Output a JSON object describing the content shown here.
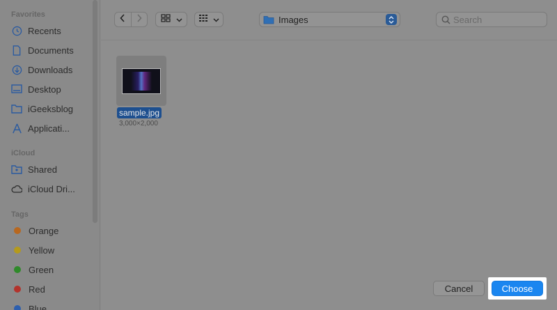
{
  "sidebar": {
    "favorites_header": "Favorites",
    "favorites": [
      {
        "label": "Recents",
        "icon": "clock-icon"
      },
      {
        "label": "Documents",
        "icon": "document-icon"
      },
      {
        "label": "Downloads",
        "icon": "download-icon"
      },
      {
        "label": "Desktop",
        "icon": "desktop-icon"
      },
      {
        "label": "iGeeksblog",
        "icon": "folder-icon"
      },
      {
        "label": "Applicati...",
        "icon": "applications-icon"
      }
    ],
    "icloud_header": "iCloud",
    "icloud": [
      {
        "label": "Shared",
        "icon": "shared-folder-icon"
      },
      {
        "label": "iCloud Dri...",
        "icon": "cloud-icon"
      }
    ],
    "tags_header": "Tags",
    "tags": [
      {
        "label": "Orange",
        "color": "#b8681f"
      },
      {
        "label": "Yellow",
        "color": "#b59a1c"
      },
      {
        "label": "Green",
        "color": "#2f8a2a"
      },
      {
        "label": "Red",
        "color": "#b3332c"
      },
      {
        "label": "Blue",
        "color": "#2d5fae"
      }
    ]
  },
  "toolbar": {
    "back_icon": "chevron-left-icon",
    "forward_icon": "chevron-right-icon",
    "view_icon": "icon-grid-icon",
    "group_icon": "group-grid-icon",
    "path_label": "Images",
    "path_icon": "folder-icon",
    "search_placeholder": "Search"
  },
  "files": [
    {
      "name": "sample.jpg",
      "dimensions": "3,000×2,000",
      "selected": true
    }
  ],
  "buttons": {
    "cancel": "Cancel",
    "choose": "Choose"
  },
  "colors": {
    "accent": "#1a86f0",
    "selection": "#1d4f8f"
  }
}
